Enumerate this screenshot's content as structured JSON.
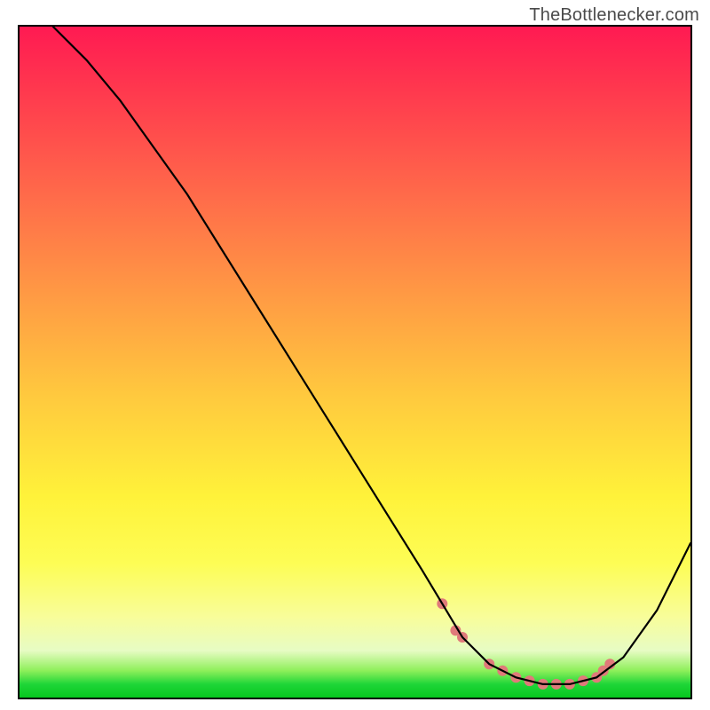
{
  "watermark": "TheBottlenecker.com",
  "chart_data": {
    "type": "line",
    "title": "",
    "xlabel": "",
    "ylabel": "",
    "xlim": [
      0,
      100
    ],
    "ylim": [
      0,
      100
    ],
    "grid": false,
    "legend": false,
    "series": [
      {
        "name": "curve",
        "color": "#000000",
        "x": [
          5,
          10,
          15,
          20,
          25,
          30,
          35,
          40,
          45,
          50,
          55,
          60,
          63,
          66,
          70,
          74,
          78,
          82,
          86,
          90,
          95,
          100
        ],
        "y": [
          100,
          95,
          89,
          82,
          75,
          67,
          59,
          51,
          43,
          35,
          27,
          19,
          14,
          9,
          5,
          3,
          2,
          2,
          3,
          6,
          13,
          23
        ]
      }
    ],
    "markers": {
      "name": "trough-markers",
      "color": "#e07a7a",
      "points": [
        {
          "x": 63,
          "y": 14
        },
        {
          "x": 65,
          "y": 10
        },
        {
          "x": 66,
          "y": 9
        },
        {
          "x": 70,
          "y": 5
        },
        {
          "x": 72,
          "y": 4
        },
        {
          "x": 74,
          "y": 3
        },
        {
          "x": 76,
          "y": 2.5
        },
        {
          "x": 78,
          "y": 2
        },
        {
          "x": 80,
          "y": 2
        },
        {
          "x": 82,
          "y": 2
        },
        {
          "x": 84,
          "y": 2.5
        },
        {
          "x": 86,
          "y": 3
        },
        {
          "x": 87,
          "y": 4
        },
        {
          "x": 88,
          "y": 5
        }
      ]
    },
    "gradient_stops": [
      {
        "pos": 0,
        "color": "#ff1a52"
      },
      {
        "pos": 10,
        "color": "#ff3a4e"
      },
      {
        "pos": 25,
        "color": "#ff6a4a"
      },
      {
        "pos": 40,
        "color": "#ff9a44"
      },
      {
        "pos": 55,
        "color": "#ffc93e"
      },
      {
        "pos": 70,
        "color": "#fff23a"
      },
      {
        "pos": 80,
        "color": "#fdfd55"
      },
      {
        "pos": 88,
        "color": "#f8fd9a"
      },
      {
        "pos": 93,
        "color": "#e7fcc4"
      },
      {
        "pos": 96,
        "color": "#8def5a"
      },
      {
        "pos": 98,
        "color": "#1fd638"
      },
      {
        "pos": 100,
        "color": "#06c71f"
      }
    ]
  }
}
